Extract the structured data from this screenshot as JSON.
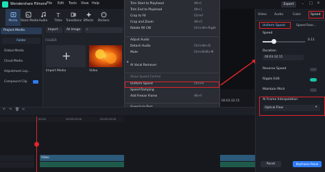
{
  "app": {
    "title": "Wondershare Filmora",
    "export_label": "Export"
  },
  "menubar": [
    "File",
    "Edit",
    "Tools",
    "View",
    "Help"
  ],
  "media_tools": [
    {
      "label": "Media",
      "icon": "media-icon",
      "active": true
    },
    {
      "label": "Stock Media",
      "icon": "stock-media-icon"
    },
    {
      "label": "Audio",
      "icon": "audio-icon"
    },
    {
      "label": "Titles",
      "icon": "titles-icon"
    },
    {
      "label": "Transitions",
      "icon": "transitions-icon"
    },
    {
      "label": "Effects",
      "icon": "effects-icon"
    },
    {
      "label": "Stickers",
      "icon": "stickers-icon"
    }
  ],
  "left_panel": {
    "project_media": "Project Media",
    "folder": "Folder",
    "items": [
      "Global Media",
      "Cloud Media",
      "Adjustment Lay...",
      "Compound Clip"
    ]
  },
  "media_area": {
    "import_label": "Import",
    "filter_label": "All Image",
    "folder_label": "FOLDER",
    "tiles": [
      {
        "label": "Import Media"
      },
      {
        "label": "Video"
      }
    ]
  },
  "context_menu": {
    "items": [
      {
        "label": "Trim Start to Playhead",
        "shortcut": "Alt+["
      },
      {
        "label": "Trim End to Playhead",
        "shortcut": "Alt+]"
      },
      {
        "label": "Crop to Fit",
        "shortcut": "Ctrl+F"
      },
      {
        "label": "Crop and Zoom",
        "shortcut": "Alt+C"
      },
      {
        "label": "Rotate 90 CW",
        "shortcut": "Ctrl+Alt+Right"
      },
      {
        "label": "Adjust Audio",
        "shortcut": ""
      },
      {
        "label": "Detach Audio",
        "shortcut": "Ctrl+Alt+D"
      },
      {
        "label": "Mute",
        "shortcut": "Ctrl+Shift+M"
      },
      {
        "label": "AI Vocal Remover",
        "shortcut": ""
      },
      {
        "label": "Show Speed Control",
        "shortcut": ""
      },
      {
        "label": "Uniform Speed",
        "shortcut": "Ctrl+R",
        "highlighted": true
      },
      {
        "label": "Speed Ramping",
        "shortcut": ""
      },
      {
        "label": "Add Freeze Frame",
        "shortcut": "Alt+F"
      },
      {
        "label": "Speech-to-Text",
        "shortcut": ""
      },
      {
        "label": "Smart Edit Tool",
        "shortcut": ""
      },
      {
        "label": "Color Match",
        "shortcut": "Alt+M"
      },
      {
        "label": "Copy Effect",
        "shortcut": "Ctrl+Alt+C"
      },
      {
        "label": "Paste Effect",
        "shortcut": "Ctrl+Alt+V"
      },
      {
        "label": "Delete Effect",
        "shortcut": ""
      },
      {
        "label": "Paste Keyframe",
        "shortcut": ""
      }
    ]
  },
  "right_panel": {
    "tabs": [
      "Video",
      "Audio",
      "Color",
      "Speed"
    ],
    "active_tab": "Speed",
    "subtabs": [
      "Uniform Speed",
      "Speed Ram..."
    ],
    "speed_label": "Speed",
    "speed_value": "0.11",
    "speed_fraction": 0.2,
    "duration_label": "Duration",
    "duration_value": "00:03:32:15",
    "toggles": [
      {
        "label": "Reverse Speed",
        "on": false
      },
      {
        "label": "Ripple Edit",
        "on": true
      },
      {
        "label": "Maintain Pitch",
        "on": false
      }
    ],
    "ai_frame_label": "AI Frame Interpolation",
    "ai_frame_value": "Optical Flow",
    "reset_label": "Reset",
    "keyframe_label": "Keyframe Panel"
  },
  "player": {
    "timecode": "00:03:32:15"
  },
  "timeline": {
    "ticks": [
      "00:00",
      "00:00:05:00",
      "00:00:10:00"
    ],
    "video_clip_label": "Video"
  },
  "colors": {
    "accent": "#2f7cf6",
    "highlight_red": "#e3242b",
    "toggle_on": "#19c7a9"
  }
}
